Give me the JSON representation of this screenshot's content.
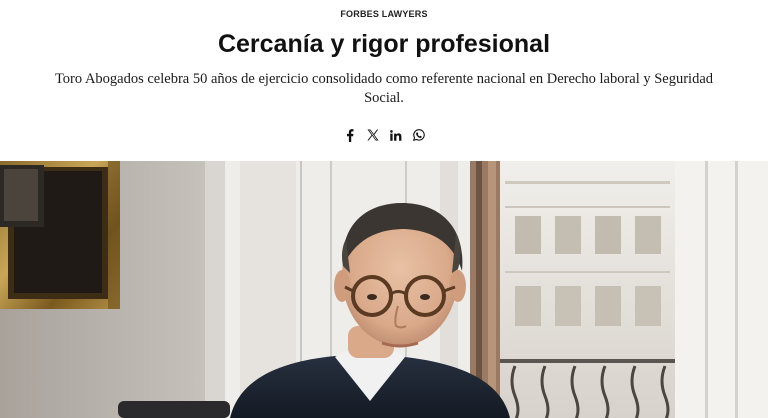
{
  "article": {
    "kicker": "FORBES LAWYERS",
    "title": "Cercanía y rigor profesional",
    "subtitle": "Toro Abogados celebra 50 años de ejercicio consolidado como referente nacional en Derecho laboral y Seguridad Social."
  },
  "share": {
    "icons": [
      "facebook-icon",
      "x-icon",
      "linkedin-icon",
      "whatsapp-icon"
    ]
  },
  "colors": {
    "text": "#111111",
    "background": "#ffffff"
  }
}
